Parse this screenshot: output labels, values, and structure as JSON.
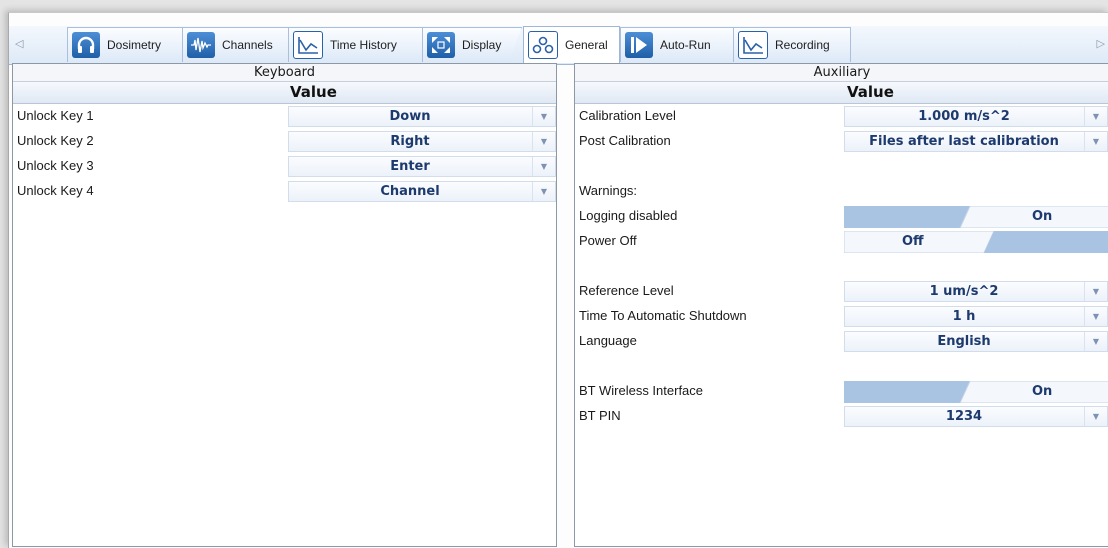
{
  "tabs": [
    {
      "label": "Dosimetry",
      "icon": "headphones-icon"
    },
    {
      "label": "Channels",
      "icon": "waveform-icon"
    },
    {
      "label": "Time History",
      "icon": "line-graph-icon"
    },
    {
      "label": "Display",
      "icon": "expand-icon"
    },
    {
      "label": "General",
      "icon": "gears-icon"
    },
    {
      "label": "Auto-Run",
      "icon": "play-icon"
    },
    {
      "label": "Recording",
      "icon": "line-graph-icon"
    }
  ],
  "active_tab": "General",
  "keyboard": {
    "title": "Keyboard",
    "value_header": "Value",
    "rows": [
      {
        "label": "Unlock Key 1",
        "value": "Down"
      },
      {
        "label": "Unlock Key 2",
        "value": "Right"
      },
      {
        "label": "Unlock Key 3",
        "value": "Enter"
      },
      {
        "label": "Unlock Key 4",
        "value": "Channel"
      }
    ]
  },
  "auxiliary": {
    "title": "Auxiliary",
    "value_header": "Value",
    "calibration_level": {
      "label": "Calibration Level",
      "value": "1.000 m/s^2"
    },
    "post_calibration": {
      "label": "Post Calibration",
      "value": "Files after last calibration"
    },
    "warnings_label": "Warnings:",
    "logging_disabled": {
      "label": "Logging disabled",
      "value": "On"
    },
    "power_off": {
      "label": "Power Off",
      "value": "Off"
    },
    "reference_level": {
      "label": "Reference Level",
      "value": "1 um/s^2"
    },
    "auto_shutdown": {
      "label": "Time To Automatic Shutdown",
      "value": "1 h"
    },
    "language": {
      "label": "Language",
      "value": "English"
    },
    "bt_wireless": {
      "label": "BT Wireless Interface",
      "value": "On"
    },
    "bt_pin": {
      "label": "BT PIN",
      "value": "1234"
    }
  },
  "colors": {
    "accent_blue": "#1f5fa8",
    "toggle_blue": "#a9c4e2",
    "value_text": "#1d3a6e"
  }
}
